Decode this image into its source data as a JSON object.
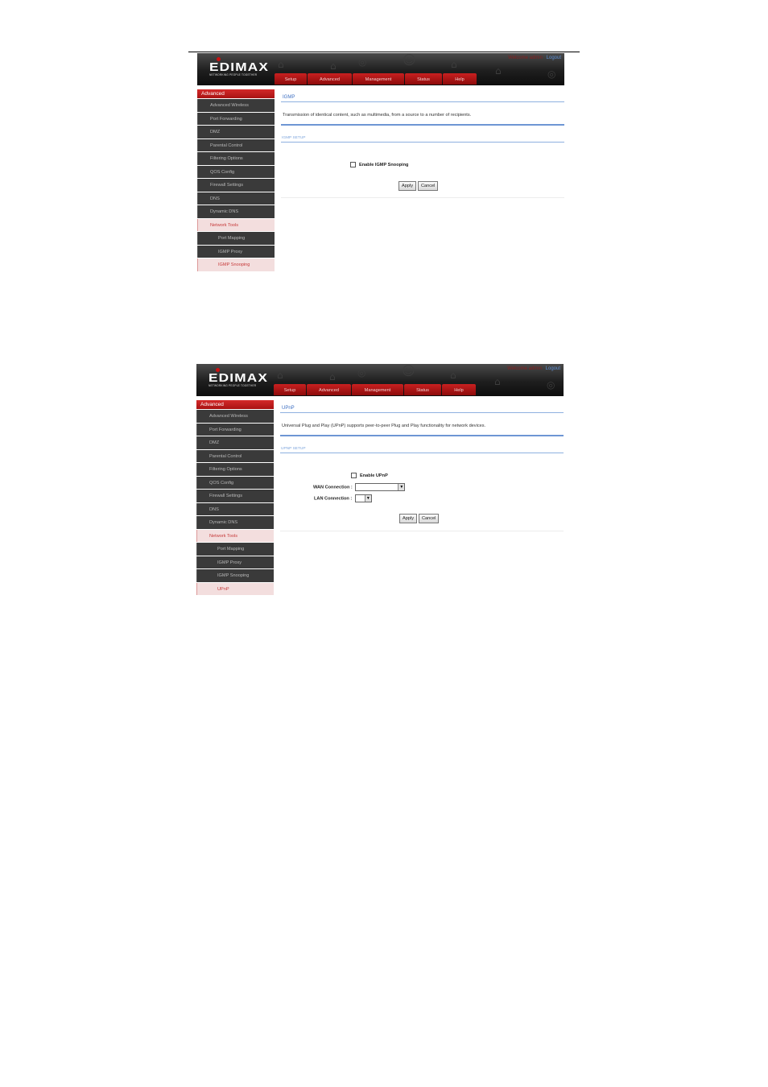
{
  "screen1": {
    "brand": {
      "logo": "EDIMAX",
      "tagline": "NETWORKING PEOPLE TOGETHER"
    },
    "header": {
      "user_link": "Welcome admin",
      "logout": "Logout"
    },
    "tabs": [
      "Setup",
      "Advanced",
      "Management",
      "Status",
      "Help"
    ],
    "sidebar": {
      "heading": "Advanced",
      "items": [
        "Advanced Wireless",
        "Port Forwarding",
        "DMZ",
        "Parental Control",
        "Filtering Options",
        "QOS Config",
        "Firewall Settings",
        "DNS",
        "Dynamic DNS",
        "Network Tools"
      ],
      "subitems": [
        "Port Mapping",
        "IGMP Proxy",
        "IGMP Snooping"
      ]
    },
    "content": {
      "title": "IGMP",
      "description": "Transmission of identical content, such as multimedia, from a source to a number of recipients.",
      "section": "IGMP SETUP",
      "checkbox_label": "Enable IGMP Snooping",
      "apply": "Apply",
      "cancel": "Cancel"
    }
  },
  "screen2": {
    "brand": {
      "logo": "EDIMAX",
      "tagline": "NETWORKING PEOPLE TOGETHER"
    },
    "header": {
      "user_link": "Welcome admin",
      "logout": "Logout"
    },
    "tabs": [
      "Setup",
      "Advanced",
      "Management",
      "Status",
      "Help"
    ],
    "sidebar": {
      "heading": "Advanced",
      "items": [
        "Advanced Wireless",
        "Port Forwarding",
        "DMZ",
        "Parental Control",
        "Filtering Options",
        "QOS Config",
        "Firewall Settings",
        "DNS",
        "Dynamic DNS",
        "Network Tools"
      ],
      "subitems": [
        "Port Mapping",
        "IGMP Proxy",
        "IGMP Snooping",
        "UPnP"
      ]
    },
    "content": {
      "title": "UPnP",
      "description": "Universal Plug and Play (UPnP) supports peer-to-peer Plug and Play functionality for network devices.",
      "section": "UPNP SETUP",
      "checkbox_label": "Enable UPnP",
      "wan_label": "WAN Connection :",
      "wan_value": "",
      "lan_label": "LAN Connection :",
      "lan_value": "",
      "apply": "Apply",
      "cancel": "Cancel"
    }
  },
  "icons": [
    "chevron-down-icon",
    "house-icon",
    "globe-icon",
    "smiley-icon"
  ]
}
